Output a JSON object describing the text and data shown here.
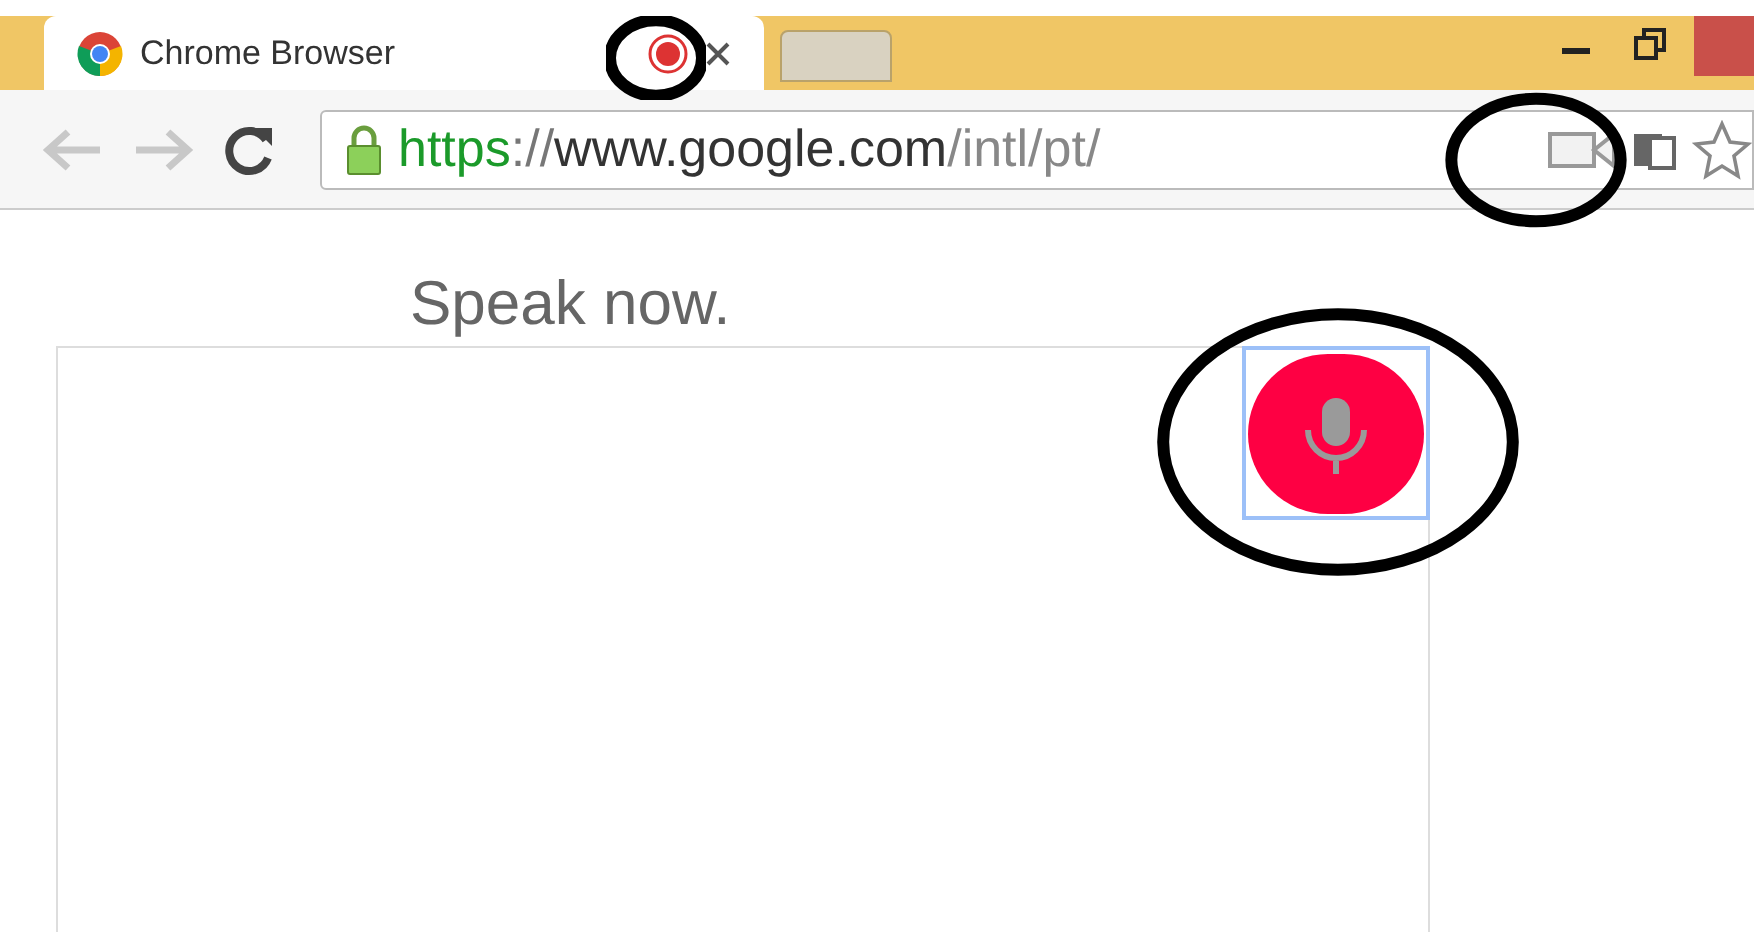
{
  "tab": {
    "title": "Chrome Browser",
    "recording": true,
    "selected": true
  },
  "new_tab": {
    "selected": false
  },
  "toolbar": {
    "back_disabled": true,
    "forward_disabled": true
  },
  "address_bar": {
    "secure": true,
    "url_parts": [
      {
        "text": "https",
        "kind": "scheme"
      },
      {
        "text": "://",
        "kind": "punct"
      },
      {
        "text": "www.google.com",
        "kind": "host"
      },
      {
        "text": "/intl/pt/",
        "kind": "path"
      }
    ],
    "camera_active": true
  },
  "page": {
    "prompt": "Speak now.",
    "mic_focused": true
  }
}
